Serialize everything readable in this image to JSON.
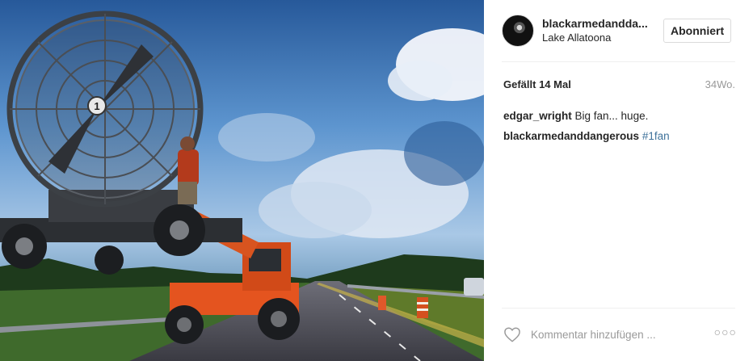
{
  "post": {
    "username": "blackarmedandda...",
    "location": "Lake Allatoona",
    "follow_label": "Abonniert",
    "likes_text": "Gefällt 14 Mal",
    "age": "34Wo.",
    "comments": [
      {
        "author": "edgar_wright",
        "text": " Big fan... huge.",
        "tag": ""
      },
      {
        "author": "blackarmedanddangerous",
        "text": " ",
        "tag": "#1fan"
      }
    ],
    "comment_placeholder": "Kommentar hinzufügen ...",
    "more_label": "○○○"
  },
  "photo": {
    "fan_badge": "1"
  },
  "icons": {
    "like": "heart-icon",
    "more": "more-options-icon"
  },
  "colors": {
    "hashtag": "#3f729b",
    "muted": "#999999",
    "border": "#dbdbdb"
  }
}
